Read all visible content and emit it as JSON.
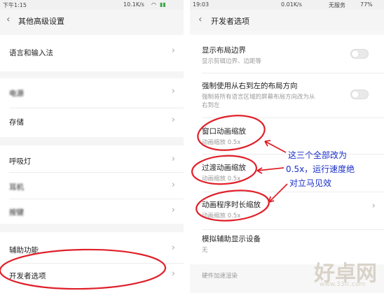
{
  "left": {
    "status": {
      "time": "下午1:15",
      "speed": "10.1K/s"
    },
    "title": "其他高级设置",
    "items": [
      {
        "label": "语言和输入法"
      },
      {
        "label": "电源"
      },
      {
        "label": "存储"
      },
      {
        "label": "呼吸灯"
      },
      {
        "label": "耳机"
      },
      {
        "label": "按键"
      },
      {
        "label": "辅助功能"
      },
      {
        "label": "开发者选项"
      }
    ]
  },
  "right": {
    "status": {
      "time": "19:03",
      "speed": "0.01K/s",
      "carrier": "无服务",
      "battery": "77%"
    },
    "title": "开发者选项",
    "items": [
      {
        "label": "显示布局边界",
        "sub": "显示剪辑边界、边距等"
      },
      {
        "label": "强制使用从右到左的布局方向",
        "sub": "强制将所有语言区域的屏幕布局方向改为从",
        "sub2": "右到左"
      },
      {
        "label": "窗口动画缩放",
        "sub": "动画缩放 0.5x"
      },
      {
        "label": "过渡动画缩放",
        "sub": "动画缩放 0.5x"
      },
      {
        "label": "动画程序时长缩放",
        "sub": "动画缩放 0.5x"
      },
      {
        "label": "模拟辅助显示设备",
        "sub": "无"
      },
      {
        "label": "硬件加速渲染"
      }
    ]
  },
  "annotation": {
    "lines": [
      "这三个全部改为",
      "0.5x，运行速度绝",
      "对立马见效"
    ],
    "color": "#1a2fc8",
    "circle_color": "#e0202a"
  },
  "watermark": {
    "brand": "好卓网",
    "url": "www.33lc.com"
  }
}
